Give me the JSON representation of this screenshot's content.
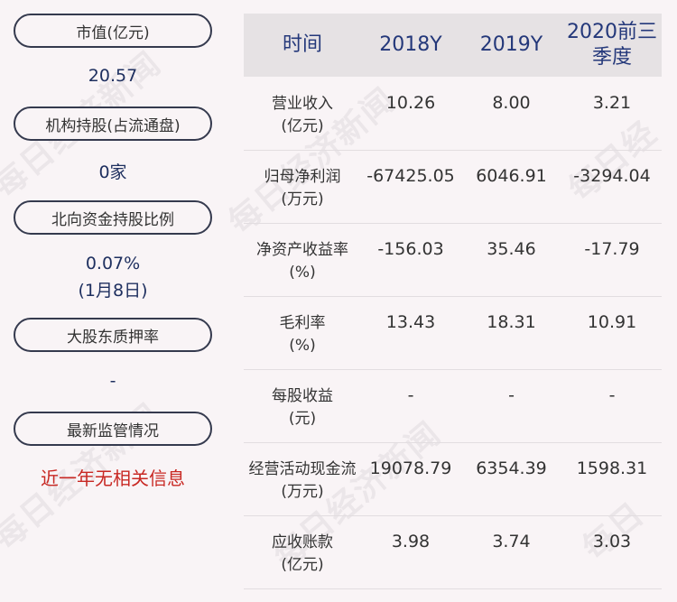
{
  "left": {
    "items": [
      {
        "label": "市值(亿元)",
        "value": "20.57"
      },
      {
        "label": "机构持股(占流通盘)",
        "value": "0家"
      },
      {
        "label": "北向资金持股比例",
        "value": "0.07%",
        "value2": "(1月8日)"
      },
      {
        "label": "大股东质押率",
        "value": "-"
      },
      {
        "label": "最新监管情况",
        "value": "近一年无相关信息"
      }
    ]
  },
  "table": {
    "headers": [
      "时间",
      "2018Y",
      "2019Y",
      "2020前三",
      "季度"
    ],
    "rows": [
      {
        "label": "营业收入",
        "unit": "(亿元)",
        "values": [
          "10.26",
          "8.00",
          "3.21"
        ]
      },
      {
        "label": "归母净利润",
        "unit": "(万元)",
        "values": [
          "-67425.05",
          "6046.91",
          "-3294.04"
        ]
      },
      {
        "label": "净资产收益率",
        "unit": "(%)",
        "values": [
          "-156.03",
          "35.46",
          "-17.79"
        ]
      },
      {
        "label": "毛利率",
        "unit": "(%)",
        "values": [
          "13.43",
          "18.31",
          "10.91"
        ]
      },
      {
        "label": "每股收益",
        "unit": "(元)",
        "values": [
          "-",
          "-",
          "-"
        ]
      },
      {
        "label": "经营活动现金流",
        "unit": "(万元)",
        "values": [
          "19078.79",
          "6354.39",
          "1598.31"
        ]
      },
      {
        "label": "应收账款",
        "unit": "(亿元)",
        "values": [
          "3.98",
          "3.74",
          "3.03"
        ]
      }
    ]
  },
  "watermark": "每日经济新闻",
  "colors": {
    "background": "#f9f4f6",
    "header_bg": "#e6e2e4",
    "header_text": "#24387a",
    "value_text": "#1e2f5f",
    "alert_text": "#c82823",
    "pill_border": "#353a4e"
  }
}
